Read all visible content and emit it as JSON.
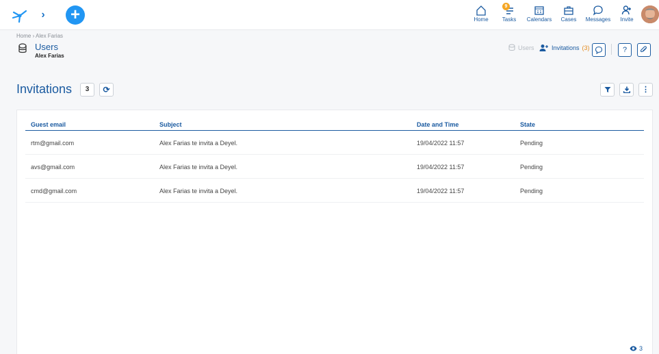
{
  "nav": {
    "home": "Home",
    "tasks": "Tasks",
    "tasks_badge": "9",
    "calendars": "Calendars",
    "cases": "Cases",
    "messages": "Messages",
    "invite": "Invite"
  },
  "breadcrumb": "Home › Alex Farias",
  "entity": {
    "name": "Users",
    "sub": "Alex Farias"
  },
  "header_links": {
    "users": "Users",
    "invitations": "Invitations",
    "invitations_count": "(3)"
  },
  "page": {
    "title": "Invitations",
    "count": "3"
  },
  "table": {
    "headers": [
      "Guest email",
      "Subject",
      "Date and Time",
      "State"
    ],
    "rows": [
      [
        "rtm@gmail.com",
        "Alex Farias te invita a Deyel.",
        "19/04/2022 11:57",
        "Pending"
      ],
      [
        "avs@gmail.com",
        "Alex Farias te invita a Deyel.",
        "19/04/2022 11:57",
        "Pending"
      ],
      [
        "cmd@gmail.com",
        "Alex Farias te invita a Deyel.",
        "19/04/2022 11:57",
        "Pending"
      ]
    ]
  },
  "footer": {
    "views": "3"
  },
  "colors": {
    "primary": "#1a5aa0",
    "accent": "#2196f3",
    "badge": "#f5a623"
  }
}
